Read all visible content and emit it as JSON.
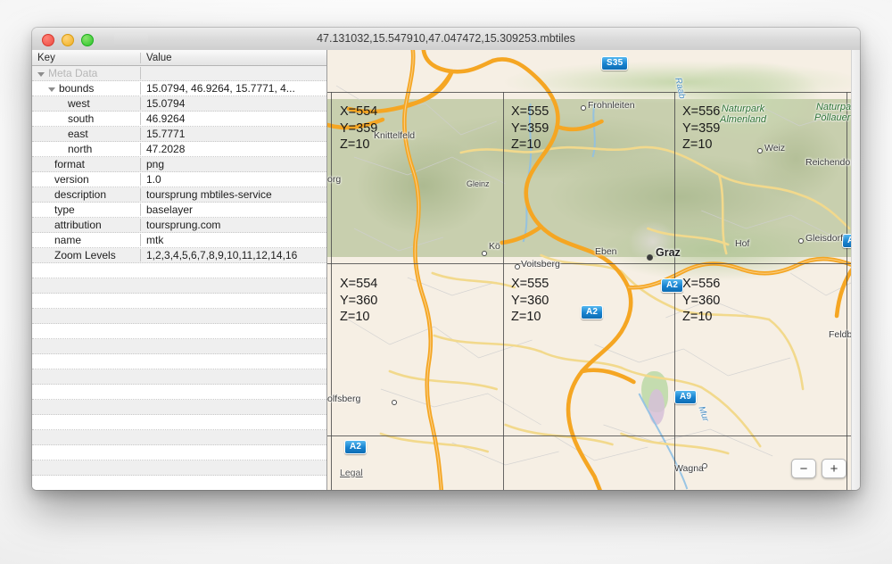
{
  "window": {
    "title": "47.131032,15.547910,47.047472,15.309253.mbtiles",
    "controls": {
      "close": "close",
      "minimize": "minimize",
      "zoom": "zoom"
    }
  },
  "sidebar": {
    "columns": {
      "key": "Key",
      "value": "Value"
    },
    "group_label": "Meta Data",
    "rows": [
      {
        "key": "bounds",
        "value": "15.0794, 46.9264, 15.7771, 4...",
        "indent": 1,
        "expandable": true
      },
      {
        "key": "west",
        "value": "15.0794",
        "indent": 2,
        "expandable": false
      },
      {
        "key": "south",
        "value": "46.9264",
        "indent": 2,
        "expandable": false
      },
      {
        "key": "east",
        "value": "15.7771",
        "indent": 2,
        "expandable": false
      },
      {
        "key": "north",
        "value": "47.2028",
        "indent": 2,
        "expandable": false
      },
      {
        "key": "format",
        "value": "png",
        "indent": 1,
        "expandable": false
      },
      {
        "key": "version",
        "value": "1.0",
        "indent": 1,
        "expandable": false
      },
      {
        "key": "description",
        "value": "toursprung mbtiles-service",
        "indent": 1,
        "expandable": false
      },
      {
        "key": "type",
        "value": "baselayer",
        "indent": 1,
        "expandable": false
      },
      {
        "key": "attribution",
        "value": "toursprung.com",
        "indent": 1,
        "expandable": false
      },
      {
        "key": "name",
        "value": "mtk",
        "indent": 1,
        "expandable": false
      },
      {
        "key": "Zoom Levels",
        "value": "1,2,3,4,5,6,7,8,9,10,11,12,14,16",
        "indent": 0,
        "expandable": false
      }
    ]
  },
  "map": {
    "tiles": [
      {
        "x": "X=554",
        "y": "Y=359",
        "z": "Z=10"
      },
      {
        "x": "X=555",
        "y": "Y=359",
        "z": "Z=10"
      },
      {
        "x": "X=556",
        "y": "Y=359",
        "z": "Z=10"
      },
      {
        "x": "X=554",
        "y": "Y=360",
        "z": "Z=10"
      },
      {
        "x": "X=555",
        "y": "Y=360",
        "z": "Z=10"
      },
      {
        "x": "X=556",
        "y": "Y=360",
        "z": "Z=10"
      }
    ],
    "shields": [
      {
        "label": "S35"
      },
      {
        "label": "A2"
      },
      {
        "label": "A2"
      },
      {
        "label": "A2"
      },
      {
        "label": "A2"
      },
      {
        "label": "A9"
      }
    ],
    "places": [
      {
        "name": "Knittelfeld"
      },
      {
        "name": "Frohnleiten"
      },
      {
        "name": "Weiz"
      },
      {
        "name": "Reichendorf"
      },
      {
        "name": "Gleisdorf"
      },
      {
        "name": "Graz"
      },
      {
        "name": "Eben"
      },
      {
        "name": "Hof"
      },
      {
        "name": "Kö"
      },
      {
        "name": "Voitsberg"
      },
      {
        "name": "org"
      },
      {
        "name": "olfsberg"
      },
      {
        "name": "Wagna"
      },
      {
        "name": "Feldb"
      },
      {
        "name": "Gleinz"
      }
    ],
    "parks": [
      {
        "line1": "Naturpark",
        "line2": "Almenland"
      },
      {
        "line1": "Naturpark",
        "line2": "Pöllauer T."
      }
    ],
    "water": [
      {
        "name": "Raab"
      },
      {
        "name": "Mur"
      }
    ],
    "legal_link": "Legal",
    "zoom_out": "−",
    "zoom_in": "+"
  }
}
